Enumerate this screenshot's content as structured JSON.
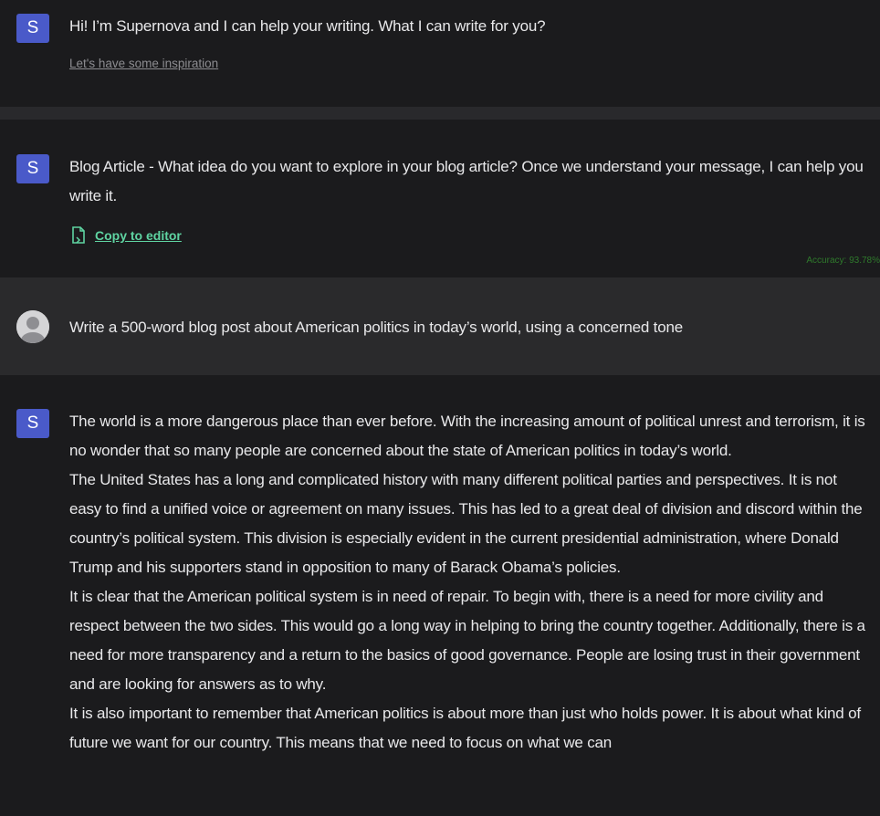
{
  "messages": {
    "greeting": {
      "avatar_letter": "S",
      "text": "Hi! I’m Supernova and I can help your writing. What I can write for you?",
      "inspiration_link": "Let's have some inspiration"
    },
    "blog_prompt": {
      "avatar_letter": "S",
      "text": "Blog Article - What idea do you want to explore in your blog article? Once we understand your message, I can help you write it.",
      "copy_label": "Copy to editor",
      "accuracy": "Accuracy: 93.78%"
    },
    "user_request": {
      "text": "Write a 500-word blog post about American politics in today’s world, using a concerned tone"
    },
    "response": {
      "avatar_letter": "S",
      "paragraphs": [
        "The world is a more dangerous place than ever before. With the increasing amount of political unrest and terrorism, it is no wonder that so many people are concerned about the state of American politics in today’s world.",
        "The United States has a long and complicated history with many different political parties and perspectives. It is not easy to find a unified voice or agreement on many issues. This has led to a great deal of division and discord within the country’s political system. This division is especially evident in the current presidential administration, where Donald Trump and his supporters stand in opposition to many of Barack Obama’s policies.",
        "It is clear that the American political system is in need of repair. To begin with, there is a need for more civility and respect between the two sides. This would go a long way in helping to bring the country together. Additionally, there is a need for more transparency and a return to the basics of good governance. People are losing trust in their government and are looking for answers as to why.",
        "It is also important to remember that American politics is about more than just who holds power. It is about what kind of future we want for our country. This means that we need to focus on what we can"
      ]
    }
  },
  "colors": {
    "background": "#1b1b1d",
    "user_row_background": "#2a2a2c",
    "separator": "#29292c",
    "avatar_accent": "#4a5ac9",
    "copy_link": "#5fd4a2",
    "accuracy_text": "#2f7a2c"
  },
  "icons": {
    "copy": "copy-document-icon",
    "user_avatar": "user-avatar-icon"
  }
}
